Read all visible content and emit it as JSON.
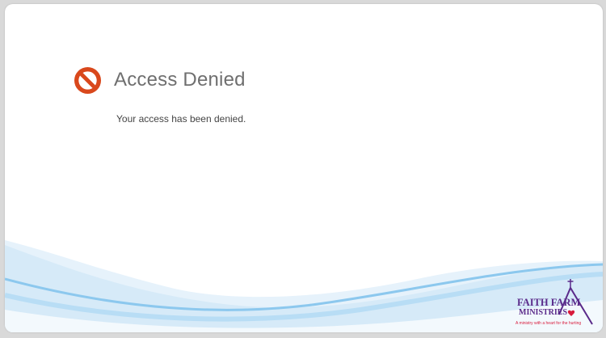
{
  "page": {
    "title": "Access Denied",
    "message": "Your access has been denied."
  },
  "logo": {
    "line1": "Faith Farm",
    "line2": "Ministries",
    "tagline": "A ministry with a heart for the hurting"
  },
  "colors": {
    "title": "#6f6f6f",
    "icon": "#d9481c",
    "wave_light": "#cfe5f7",
    "wave_mid": "#9fd0f2",
    "logo_purple": "#5a2a8a",
    "logo_heart": "#d81b3c"
  }
}
